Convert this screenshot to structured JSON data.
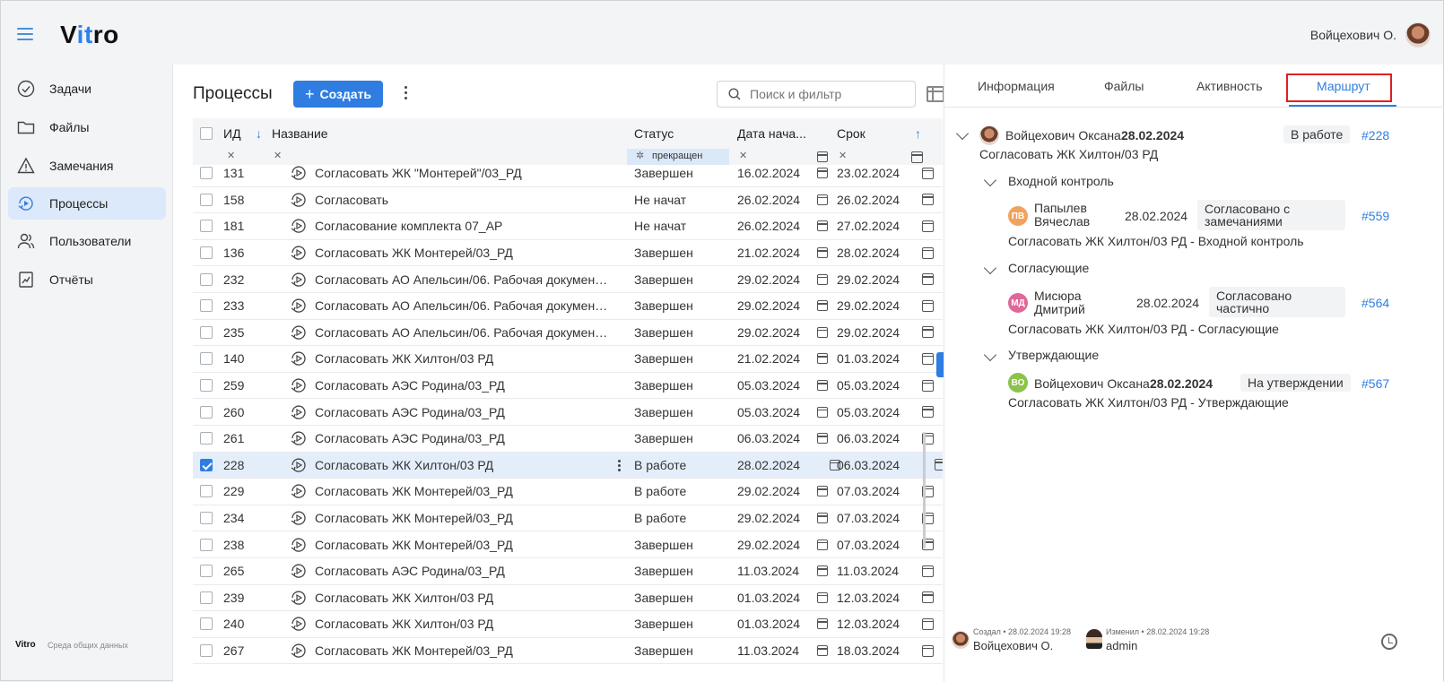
{
  "header": {
    "logo_text": "Vitro",
    "logo_prefix": "V",
    "logo_accent": "it",
    "logo_suffix": "ro",
    "user_name": "Войцехович О."
  },
  "sidebar": {
    "items": [
      {
        "label": "Задачи",
        "icon": "check-circle-icon"
      },
      {
        "label": "Файлы",
        "icon": "folder-icon"
      },
      {
        "label": "Замечания",
        "icon": "warning-icon"
      },
      {
        "label": "Процессы",
        "icon": "process-icon",
        "active": true
      },
      {
        "label": "Пользователи",
        "icon": "users-icon"
      },
      {
        "label": "Отчёты",
        "icon": "report-icon"
      }
    ],
    "footer_logo": "Vitro",
    "footer_text": "Среда общих данных"
  },
  "main": {
    "title": "Процессы",
    "create_label": "Создать",
    "search_placeholder": "Поиск и фильтр",
    "columns": {
      "id": "ИД",
      "name": "Название",
      "status": "Статус",
      "start": "Дата нача...",
      "due": "Срок"
    },
    "status_filter_chip": "прекращен",
    "rows": [
      {
        "id": "131",
        "name": "Согласовать ЖК \"Монтерей\"/03_РД",
        "status": "Завершен",
        "start": "16.02.2024",
        "due": "23.02.2024"
      },
      {
        "id": "158",
        "name": "Согласовать",
        "status": "Не начат",
        "start": "26.02.2024",
        "due": "26.02.2024"
      },
      {
        "id": "181",
        "name": "Согласование комплекта 07_АР",
        "status": "Не начат",
        "start": "26.02.2024",
        "due": "27.02.2024"
      },
      {
        "id": "136",
        "name": "Согласовать ЖК Монтерей/03_РД",
        "status": "Завершен",
        "start": "21.02.2024",
        "due": "28.02.2024"
      },
      {
        "id": "232",
        "name": "Согласовать АО Апельсин/06. Рабочая документа...",
        "status": "Завершен",
        "start": "29.02.2024",
        "due": "29.02.2024"
      },
      {
        "id": "233",
        "name": "Согласовать АО Апельсин/06. Рабочая документа...",
        "status": "Завершен",
        "start": "29.02.2024",
        "due": "29.02.2024"
      },
      {
        "id": "235",
        "name": "Согласовать АО Апельсин/06. Рабочая документа...",
        "status": "Завершен",
        "start": "29.02.2024",
        "due": "29.02.2024"
      },
      {
        "id": "140",
        "name": "Согласовать ЖК Хилтон/03 РД",
        "status": "Завершен",
        "start": "21.02.2024",
        "due": "01.03.2024"
      },
      {
        "id": "259",
        "name": "Согласовать АЭС Родина/03_РД",
        "status": "Завершен",
        "start": "05.03.2024",
        "due": "05.03.2024"
      },
      {
        "id": "260",
        "name": "Согласовать АЭС Родина/03_РД",
        "status": "Завершен",
        "start": "05.03.2024",
        "due": "05.03.2024"
      },
      {
        "id": "261",
        "name": "Согласовать АЭС Родина/03_РД",
        "status": "Завершен",
        "start": "06.03.2024",
        "due": "06.03.2024"
      },
      {
        "id": "228",
        "name": "Согласовать ЖК Хилтон/03 РД",
        "status": "В работе",
        "start": "28.02.2024",
        "due": "06.03.2024",
        "selected": true
      },
      {
        "id": "229",
        "name": "Согласовать ЖК Монтерей/03_РД",
        "status": "В работе",
        "start": "29.02.2024",
        "due": "07.03.2024"
      },
      {
        "id": "234",
        "name": "Согласовать ЖК Монтерей/03_РД",
        "status": "В работе",
        "start": "29.02.2024",
        "due": "07.03.2024"
      },
      {
        "id": "238",
        "name": "Согласовать ЖК Монтерей/03_РД",
        "status": "Завершен",
        "start": "29.02.2024",
        "due": "07.03.2024"
      },
      {
        "id": "265",
        "name": "Согласовать АЭС Родина/03_РД",
        "status": "Завершен",
        "start": "11.03.2024",
        "due": "11.03.2024"
      },
      {
        "id": "239",
        "name": "Согласовать ЖК Хилтон/03 РД",
        "status": "Завершен",
        "start": "01.03.2024",
        "due": "12.03.2024"
      },
      {
        "id": "240",
        "name": "Согласовать ЖК Хилтон/03 РД",
        "status": "Завершен",
        "start": "01.03.2024",
        "due": "12.03.2024"
      },
      {
        "id": "267",
        "name": "Согласовать ЖК Монтерей/03_РД",
        "status": "Завершен",
        "start": "11.03.2024",
        "due": "18.03.2024"
      }
    ]
  },
  "panel": {
    "tabs": [
      "Информация",
      "Файлы",
      "Активность",
      "Маршрут"
    ],
    "active_tab": "Маршрут",
    "root": {
      "user": "Войцехович Оксана",
      "date": "28.02.2024",
      "status": "В работе",
      "link": "#228",
      "subtitle": "Согласовать ЖК Хилтон/03 РД"
    },
    "stages": [
      {
        "title": "Входной контроль",
        "initials": "ПВ",
        "user_line1": "Папылев",
        "user_line2": "Вячеслав",
        "date": "28.02.2024",
        "status_line1": "Согласовано с",
        "status_line2": "замечаниями",
        "link": "#559",
        "subtitle": "Согласовать ЖК Хилтон/03 РД - Входной контроль",
        "color": "#f0a35e"
      },
      {
        "title": "Согласующие",
        "initials": "МД",
        "user_line1": "Мисюра",
        "user_line2": "Дмитрий",
        "date": "28.02.2024",
        "status_line1": "Согласовано",
        "status_line2": "частично",
        "link": "#564",
        "subtitle": "Согласовать ЖК Хилтон/03 РД - Согласующие",
        "color": "#e0679a"
      },
      {
        "title": "Утверждающие",
        "initials": "ВО",
        "user_line1": "Войцехович Оксана",
        "user_line2": "",
        "date": "28.02.2024",
        "status_line1": "На утверждении",
        "status_line2": "",
        "link": "#567",
        "subtitle": "Согласовать ЖК Хилтон/03 РД - Утверждающие",
        "color": "#8bc34a"
      }
    ],
    "footer": {
      "created_label": "Создал • 28.02.2024 19:28",
      "created_by": "Войцехович О.",
      "modified_label": "Изменил • 28.02.2024 19:28",
      "modified_by": "admin"
    }
  }
}
